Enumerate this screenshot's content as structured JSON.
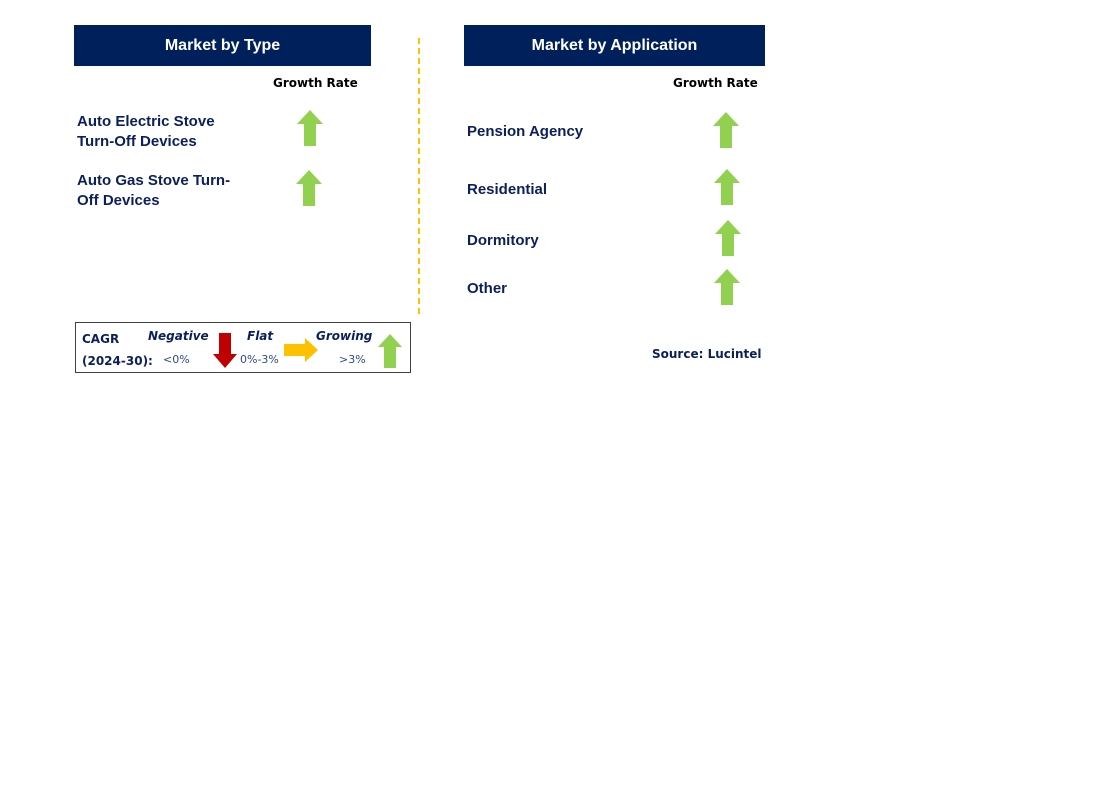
{
  "left_panel": {
    "title": "Market by Type",
    "column_header": "Growth Rate",
    "items": [
      {
        "line1": "Auto Electric Stove",
        "line2": "Turn-Off Devices",
        "trend": "growing"
      },
      {
        "line1": "Auto Gas Stove Turn-",
        "line2": "Off Devices",
        "trend": "growing"
      }
    ]
  },
  "right_panel": {
    "title": "Market by Application",
    "column_header": "Growth Rate",
    "items": [
      {
        "label": "Pension Agency",
        "trend": "growing"
      },
      {
        "label": "Residential",
        "trend": "growing"
      },
      {
        "label": "Dormitory",
        "trend": "growing"
      },
      {
        "label": "Other",
        "trend": "growing"
      }
    ],
    "source": "Source: Lucintel"
  },
  "legend": {
    "label_line1": "CAGR",
    "label_line2": "(2024-30):",
    "categories": [
      {
        "name": "Negative",
        "range": "<0%",
        "icon": "down-arrow-icon",
        "color": "#c00000"
      },
      {
        "name": "Flat",
        "range": "0%-3%",
        "icon": "right-arrow-icon",
        "color": "#ffc000"
      },
      {
        "name": "Growing",
        "range": ">3%",
        "icon": "up-arrow-icon",
        "color": "#92d050"
      }
    ]
  },
  "colors": {
    "header_bg": "#00205c",
    "text_navy": "#0b1f5c",
    "growing": "#92d050",
    "flat": "#ffc000",
    "negative": "#c00000",
    "divider": "#ffc000"
  }
}
